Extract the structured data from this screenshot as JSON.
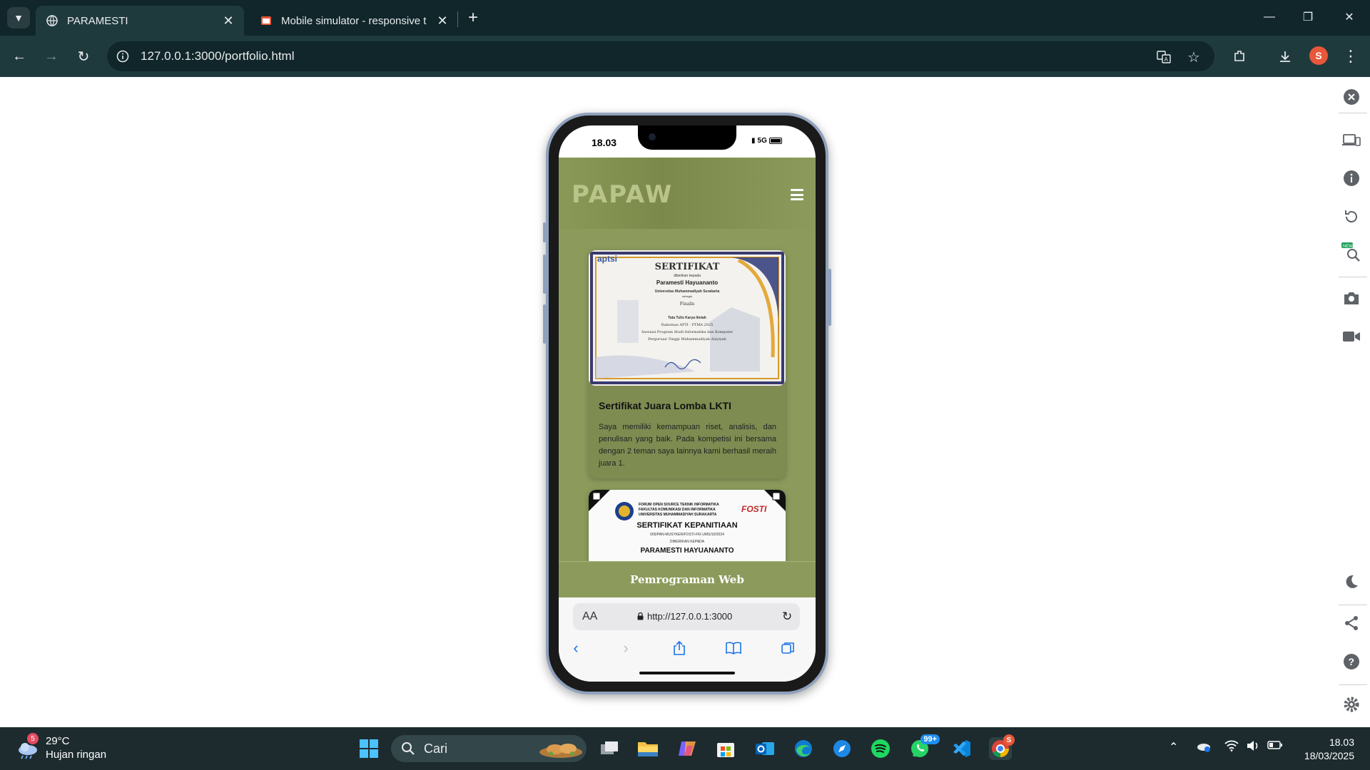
{
  "browser": {
    "tabs": [
      {
        "title": "PARAMESTI",
        "active": true
      },
      {
        "title": "Mobile simulator - responsive t",
        "active": false
      }
    ],
    "url": "127.0.0.1:3000/portfolio.html",
    "profile_initial": "S"
  },
  "phone": {
    "status_time": "18.03",
    "network": "5G",
    "app": {
      "logo": "PAPAW",
      "cards": [
        {
          "cert_title": "SERTIFIKAT",
          "cert_given_to": "diberikan kepada",
          "cert_name": "Paramesti Hayuananto",
          "cert_univ": "Universitas Muhammadiyah Surakarta",
          "cert_role": "sebagai",
          "cert_rank": "Finalis",
          "cert_event": "Tata Tulis Karya Ilmiah",
          "cert_org1": "Rakornas APTI - PTMA 2025",
          "cert_org2": "Asosiasi Program Studi Informatika dan Komputer",
          "cert_org3": "Perguruan Tinggi Muhammadiyah Aisyiyah",
          "cert_logo": "aptsi",
          "title": "Sertifikat Juara Lomba LKTI",
          "description": "Saya memiliki kemampuan riset, analisis, dan penulisan yang baik. Pada kompetisi ini bersama dengan 2 teman saya lainnya kami berhasil meraih juara 1."
        },
        {
          "cert_header1": "FORUM OPEN SOURCE TEKNIK INFORMATIKA",
          "cert_header2": "FAKULTAS KOMUNIKASI DAN INFORMATIKA",
          "cert_header3": "UNIVERSITAS MUHAMMADIYAH SURAKARTA",
          "cert_title": "SERTIFIKAT KEPANITIAAN",
          "cert_number": "005/PAN-MUSYKER/FOSTI-FKI-UMS/10/2024",
          "cert_given_to": "DIBERIKAN KEPADA",
          "cert_name": "PARAMESTI HAYUANANTO",
          "cert_logo": "FOSTI"
        }
      ],
      "footer": "Pemrograman Web"
    },
    "safari": {
      "aa": "AA",
      "url": "http://127.0.0.1:3000"
    }
  },
  "taskbar": {
    "weather_temp": "29°C",
    "weather_desc": "Hujan ringan",
    "weather_badge": "5",
    "search_label": "Cari",
    "whatsapp_badge": "99+",
    "chrome_badge": "S",
    "time": "18.03",
    "date": "18/03/2025"
  }
}
